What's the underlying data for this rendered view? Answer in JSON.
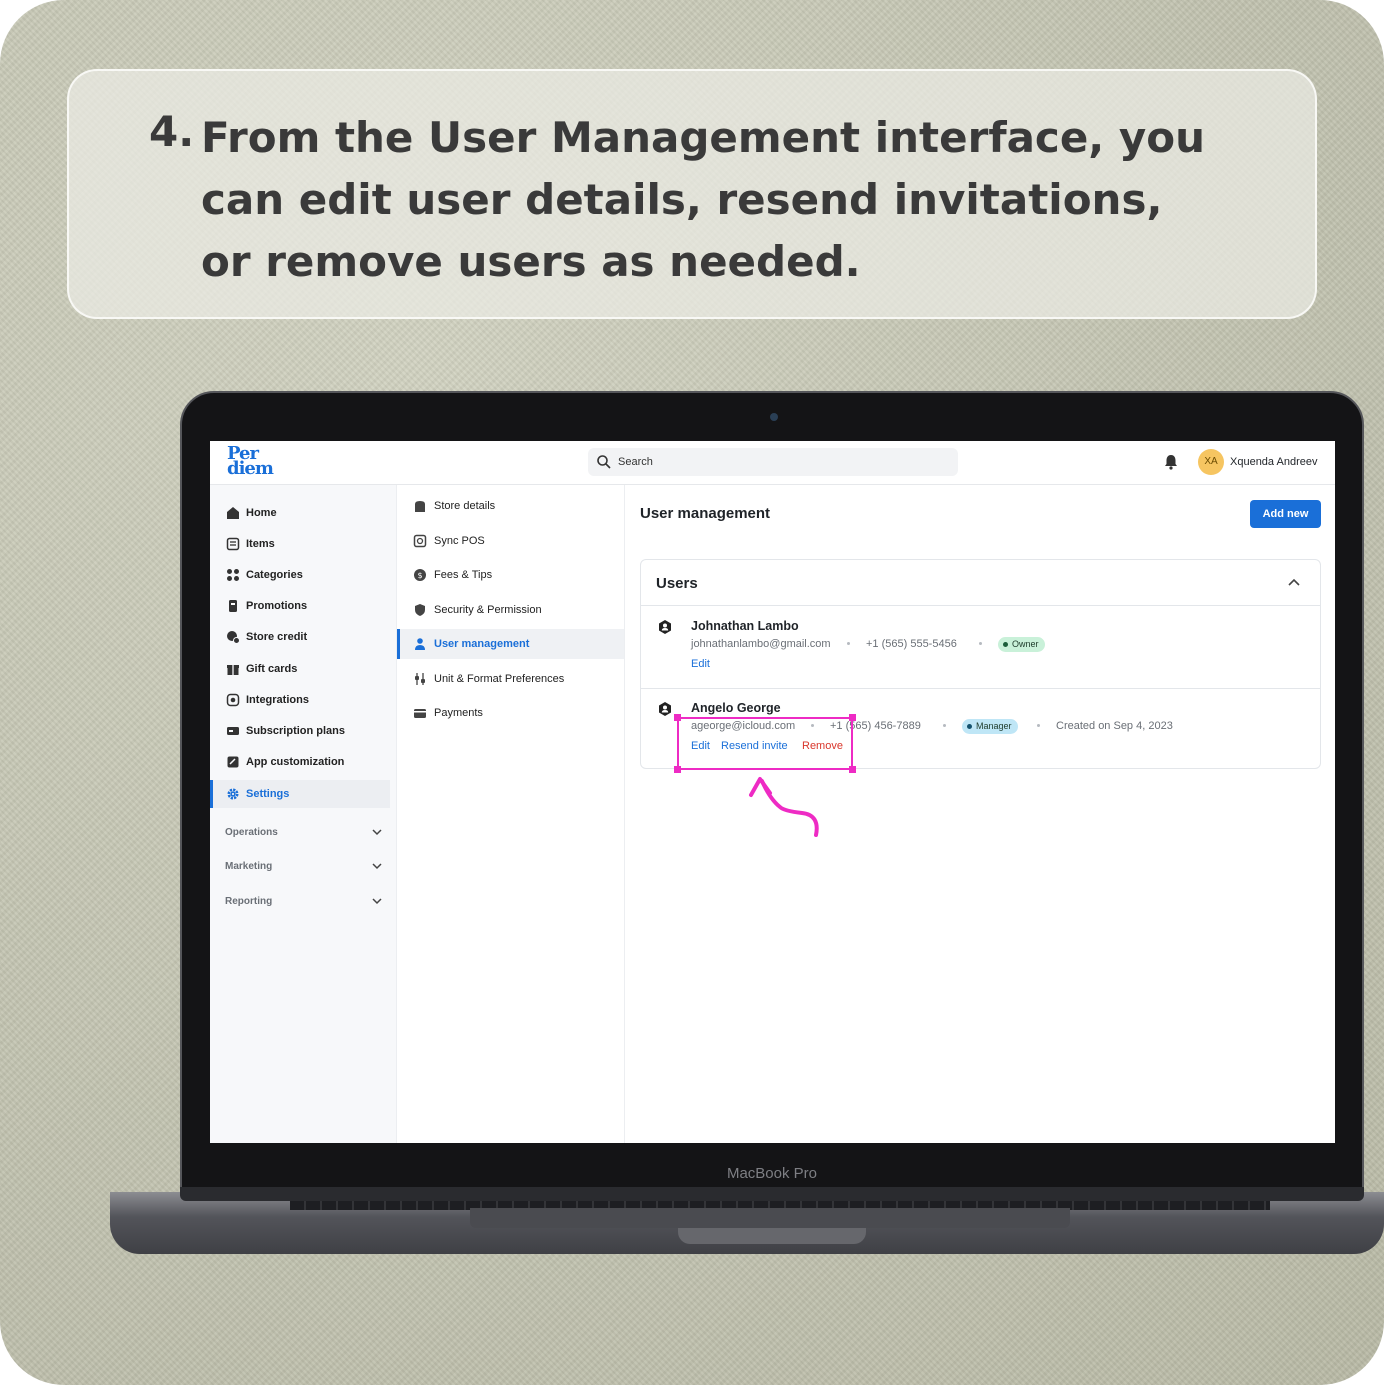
{
  "caption": {
    "step_number": "4.",
    "text": "From the User Management interface, you can edit user details, resend invitations, or remove users as needed."
  },
  "device": {
    "brand_label": "MacBook Pro"
  },
  "app": {
    "logo_line1": "Per",
    "logo_line2": "diem",
    "search": {
      "placeholder": "Search"
    },
    "user": {
      "initials": "XA",
      "name": "Xquenda Andreev"
    }
  },
  "sidebar": {
    "items": [
      {
        "label": "Home",
        "icon": "home-icon"
      },
      {
        "label": "Items",
        "icon": "items-icon"
      },
      {
        "label": "Categories",
        "icon": "categories-icon"
      },
      {
        "label": "Promotions",
        "icon": "promotions-icon"
      },
      {
        "label": "Store credit",
        "icon": "store-credit-icon"
      },
      {
        "label": "Gift cards",
        "icon": "gift-card-icon"
      },
      {
        "label": "Integrations",
        "icon": "integrations-icon"
      },
      {
        "label": "Subscription plans",
        "icon": "subscription-icon"
      },
      {
        "label": "App customization",
        "icon": "app-customization-icon"
      },
      {
        "label": "Settings",
        "icon": "gear-icon",
        "active": true
      }
    ],
    "groups": [
      {
        "label": "Operations"
      },
      {
        "label": "Marketing"
      },
      {
        "label": "Reporting"
      }
    ]
  },
  "settings_nav": {
    "items": [
      {
        "label": "Store details",
        "icon": "store-icon"
      },
      {
        "label": "Sync POS",
        "icon": "sync-icon"
      },
      {
        "label": "Fees & Tips",
        "icon": "dollar-icon"
      },
      {
        "label": "Security & Permission",
        "icon": "shield-icon"
      },
      {
        "label": "User management",
        "icon": "user-icon",
        "active": true
      },
      {
        "label": "Unit & Format Preferences",
        "icon": "sliders-icon"
      },
      {
        "label": "Payments",
        "icon": "wallet-icon"
      }
    ]
  },
  "main": {
    "title": "User management",
    "add_button": "Add new",
    "users_panel": {
      "title": "Users",
      "users": [
        {
          "name": "Johnathan Lambo",
          "email": "johnathanlambo@gmail.com",
          "phone": "+1 (565) 555-5456",
          "role": "Owner",
          "created": "",
          "actions": [
            "Edit"
          ]
        },
        {
          "name": "Angelo George",
          "email": "ageorge@icloud.com",
          "phone": "+1 (565) 456-7889",
          "role": "Manager",
          "created": "Created on Sep 4, 2023",
          "actions": [
            "Edit",
            "Resend invite",
            "Remove"
          ]
        }
      ]
    }
  },
  "colors": {
    "accent": "#1a6fd8",
    "remove": "#d9362b",
    "highlight": "#ee2bc4",
    "owner_badge": "#c9f1d9",
    "manager_badge": "#bfe6f6"
  }
}
